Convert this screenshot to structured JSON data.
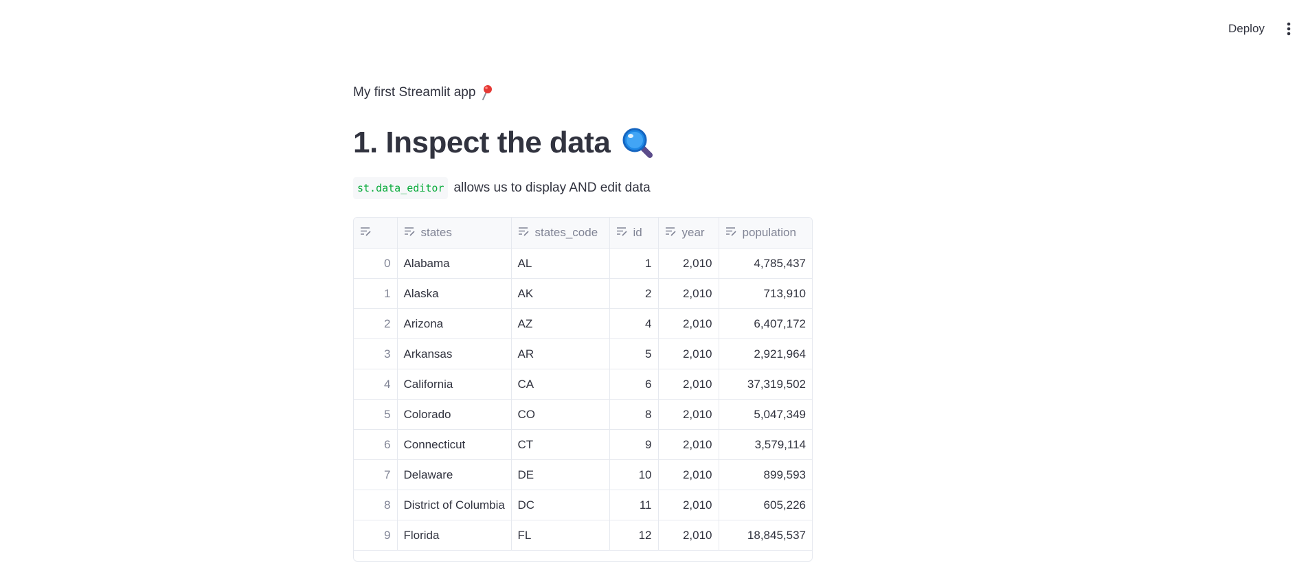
{
  "toolbar": {
    "deploy_label": "Deploy",
    "menu_icon": "vertical-dots-icon"
  },
  "main": {
    "caption": "My first Streamlit app",
    "caption_icon": "pushpin-icon",
    "title": "1. Inspect the data",
    "title_icon": "magnifying-glass-icon",
    "code_text": "st.data_editor",
    "desc_text": "allows us to display AND edit data"
  },
  "table": {
    "columns": [
      "",
      "states",
      "states_code",
      "id",
      "year",
      "population"
    ],
    "rows": [
      [
        "0",
        "Alabama",
        "AL",
        "1",
        "2,010",
        "4,785,437"
      ],
      [
        "1",
        "Alaska",
        "AK",
        "2",
        "2,010",
        "713,910"
      ],
      [
        "2",
        "Arizona",
        "AZ",
        "4",
        "2,010",
        "6,407,172"
      ],
      [
        "3",
        "Arkansas",
        "AR",
        "5",
        "2,010",
        "2,921,964"
      ],
      [
        "4",
        "California",
        "CA",
        "6",
        "2,010",
        "37,319,502"
      ],
      [
        "5",
        "Colorado",
        "CO",
        "8",
        "2,010",
        "5,047,349"
      ],
      [
        "6",
        "Connecticut",
        "CT",
        "9",
        "2,010",
        "3,579,114"
      ],
      [
        "7",
        "Delaware",
        "DE",
        "10",
        "2,010",
        "899,593"
      ],
      [
        "8",
        "District of Columbia",
        "DC",
        "11",
        "2,010",
        "605,226"
      ],
      [
        "9",
        "Florida",
        "FL",
        "12",
        "2,010",
        "18,845,537"
      ]
    ]
  },
  "colors": {
    "text": "#31333f",
    "muted": "#808495",
    "code_green": "#09ab3b",
    "border": "#e6e9ef"
  }
}
